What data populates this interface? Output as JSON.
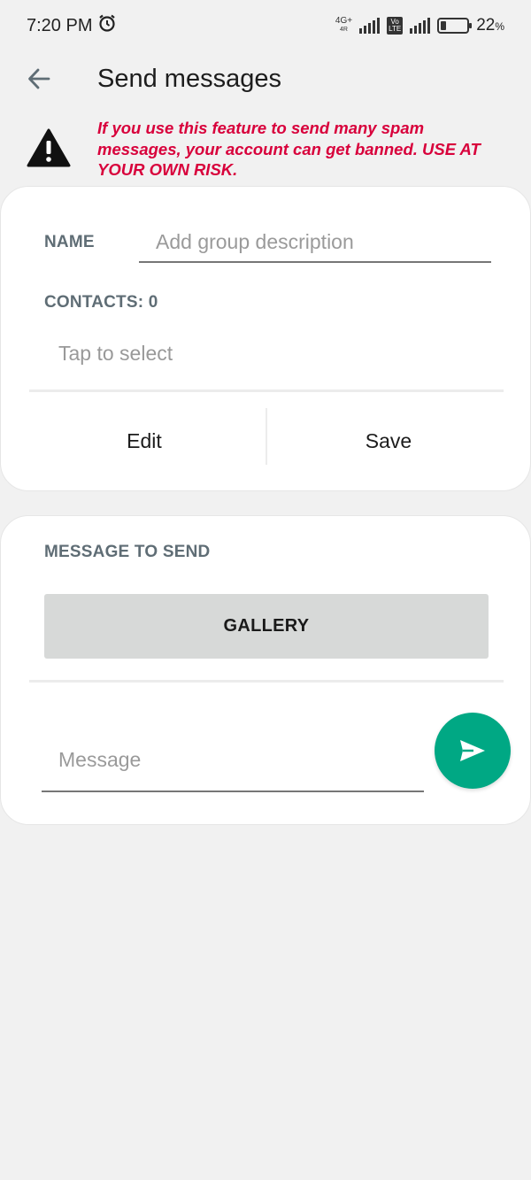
{
  "status_bar": {
    "time": "7:20 PM",
    "network_top": "4G+",
    "network_bottom": "4R",
    "volte_top": "Vo",
    "volte_bottom": "LTE",
    "battery_percent": "22",
    "battery_suffix": "%",
    "battery_level": 0.22
  },
  "toolbar": {
    "title": "Send messages"
  },
  "warning": {
    "text": "If you use this feature to send many spam messages, your account can get banned. USE AT YOUR OWN RISK."
  },
  "group_card": {
    "name_label": "NAME",
    "name_placeholder": "Add group description",
    "contacts_label": "CONTACTS: 0",
    "contacts_hint": "Tap to select",
    "edit_label": "Edit",
    "save_label": "Save"
  },
  "message_card": {
    "section_label": "MESSAGE TO SEND",
    "gallery_label": "GALLERY",
    "message_placeholder": "Message"
  },
  "colors": {
    "accent": "#00a884",
    "warning": "#d8003b",
    "label": "#5f6d75",
    "background": "#f1f1f1"
  }
}
